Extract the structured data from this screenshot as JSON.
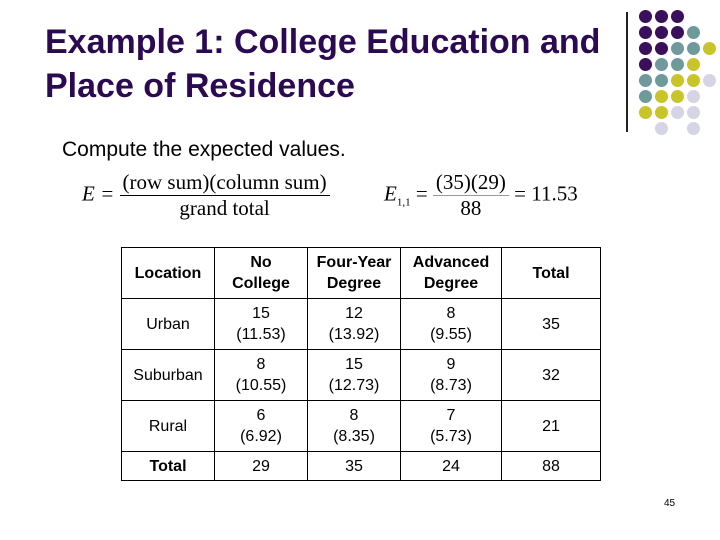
{
  "slide": {
    "title_line1": "Example 1: College Education and",
    "title_line2": "Place of Residence",
    "subtitle": "Compute the expected values.",
    "page_number": "45",
    "colors": {
      "title": "#2b0a52",
      "dot_purple": "#3a0f5c",
      "dot_teal": "#6e9a9c",
      "dot_yellow": "#c9c42a",
      "dot_lavender": "#d4d4e4"
    }
  },
  "formula": {
    "general_lhs": "E =",
    "general_numerator": "(row sum)(column sum)",
    "general_denominator": "grand total",
    "example_lhs": "E",
    "example_sub": "1,1",
    "example_eq": "=",
    "example_numerator": "(35)(29)",
    "example_denominator": "88",
    "example_result": "= 11.53"
  },
  "table": {
    "headers": [
      {
        "line1": "",
        "line2": "Location"
      },
      {
        "line1": "No",
        "line2": "College"
      },
      {
        "line1": "Four-Year",
        "line2": "Degree"
      },
      {
        "line1": "Advanced",
        "line2": "Degree"
      },
      {
        "line1": "",
        "line2": "Total"
      }
    ],
    "rows": [
      {
        "location": "Urban",
        "cells": [
          {
            "observed": "15",
            "expected": "(11.53)"
          },
          {
            "observed": "12",
            "expected": "(13.92)"
          },
          {
            "observed": "8",
            "expected": "(9.55)"
          }
        ],
        "total": "35"
      },
      {
        "location": "Suburban",
        "cells": [
          {
            "observed": "8",
            "expected": "(10.55)"
          },
          {
            "observed": "15",
            "expected": "(12.73)"
          },
          {
            "observed": "9",
            "expected": "(8.73)"
          }
        ],
        "total": "32"
      },
      {
        "location": "Rural",
        "cells": [
          {
            "observed": "6",
            "expected": "(6.92)"
          },
          {
            "observed": "8",
            "expected": "(8.35)"
          },
          {
            "observed": "7",
            "expected": "(5.73)"
          }
        ],
        "total": "21"
      }
    ],
    "totals": {
      "label": "Total",
      "values": [
        "29",
        "35",
        "24",
        "88"
      ]
    }
  },
  "decoration": {
    "dot_grid": [
      [
        "purple",
        "purple",
        "purple"
      ],
      [
        "purple",
        "purple",
        "purple",
        "teal"
      ],
      [
        "purple",
        "purple",
        "teal",
        "teal",
        "yellow"
      ],
      [
        "purple",
        "teal",
        "teal",
        "yellow"
      ],
      [
        "teal",
        "teal",
        "yellow",
        "yellow",
        "lavender"
      ],
      [
        "teal",
        "yellow",
        "yellow",
        "lavender"
      ],
      [
        "yellow",
        "yellow",
        "lavender",
        "lavender"
      ],
      [
        "",
        "lavender",
        "",
        "lavender"
      ]
    ]
  }
}
